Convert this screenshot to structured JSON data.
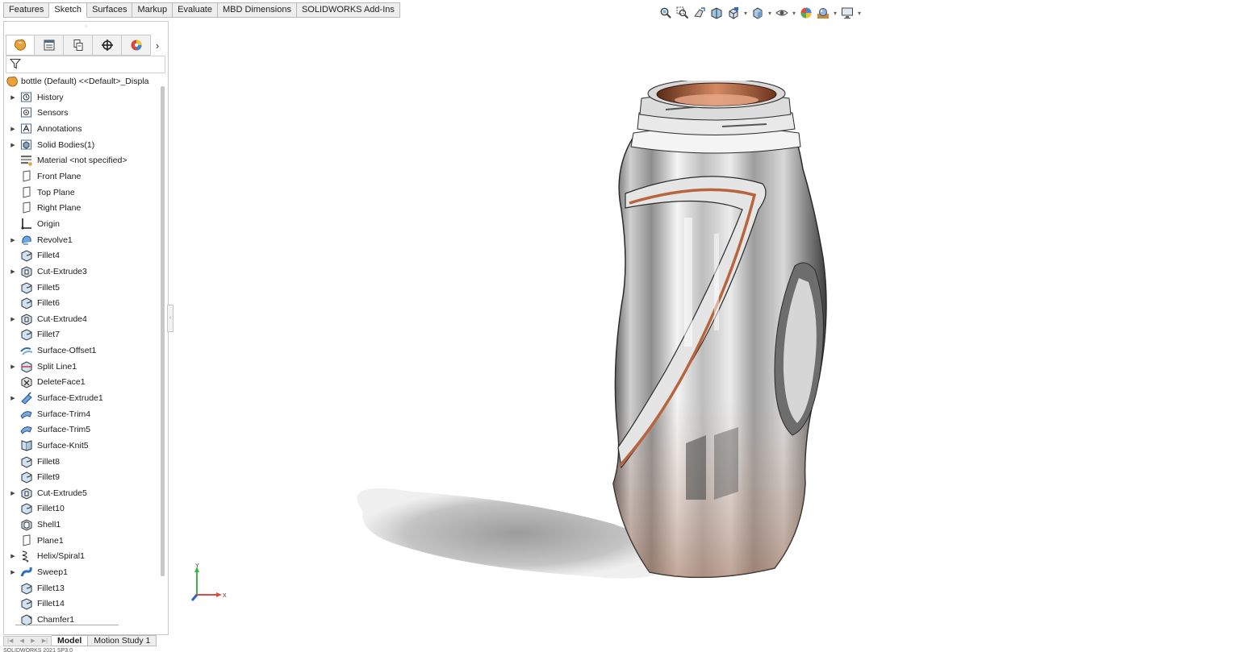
{
  "command_tabs": [
    "Features",
    "Sketch",
    "Surfaces",
    "Markup",
    "Evaluate",
    "MBD Dimensions",
    "SOLIDWORKS Add-Ins"
  ],
  "active_command_tab": "Sketch",
  "hud_icons": [
    "zoom-to-fit-icon",
    "zoom-to-area-icon",
    "previous-view-icon",
    "section-view-icon",
    "view-orientation-icon",
    "display-style-icon",
    "hide-show-items-icon",
    "edit-appearance-icon",
    "apply-scene-icon",
    "view-settings-icon"
  ],
  "feature_manager": {
    "tabs": [
      "featuremanager-tab",
      "propertymanager-tab",
      "configurationmanager-tab",
      "dimxpertmanager-tab",
      "displaymanager-tab"
    ],
    "more": "›",
    "root": "bottle (Default) <<Default>_Displa",
    "items": [
      {
        "label": "History",
        "expand": true,
        "icon": "history"
      },
      {
        "label": "Sensors",
        "expand": false,
        "icon": "sensor"
      },
      {
        "label": "Annotations",
        "expand": true,
        "icon": "annotation"
      },
      {
        "label": "Solid Bodies(1)",
        "expand": true,
        "icon": "solid-body"
      },
      {
        "label": "Material <not specified>",
        "expand": false,
        "icon": "material"
      },
      {
        "label": "Front Plane",
        "expand": false,
        "icon": "plane"
      },
      {
        "label": "Top Plane",
        "expand": false,
        "icon": "plane"
      },
      {
        "label": "Right Plane",
        "expand": false,
        "icon": "plane"
      },
      {
        "label": "Origin",
        "expand": false,
        "icon": "origin"
      },
      {
        "label": "Revolve1",
        "expand": true,
        "icon": "revolve"
      },
      {
        "label": "Fillet4",
        "expand": false,
        "icon": "fillet"
      },
      {
        "label": "Cut-Extrude3",
        "expand": true,
        "icon": "cut-extrude"
      },
      {
        "label": "Fillet5",
        "expand": false,
        "icon": "fillet"
      },
      {
        "label": "Fillet6",
        "expand": false,
        "icon": "fillet"
      },
      {
        "label": "Cut-Extrude4",
        "expand": true,
        "icon": "cut-extrude"
      },
      {
        "label": "Fillet7",
        "expand": false,
        "icon": "fillet"
      },
      {
        "label": "Surface-Offset1",
        "expand": false,
        "icon": "surface-offset"
      },
      {
        "label": "Split Line1",
        "expand": true,
        "icon": "split-line"
      },
      {
        "label": "DeleteFace1",
        "expand": false,
        "icon": "delete-face"
      },
      {
        "label": "Surface-Extrude1",
        "expand": true,
        "icon": "surface-extrude"
      },
      {
        "label": "Surface-Trim4",
        "expand": false,
        "icon": "surface-trim"
      },
      {
        "label": "Surface-Trim5",
        "expand": false,
        "icon": "surface-trim"
      },
      {
        "label": "Surface-Knit5",
        "expand": false,
        "icon": "surface-knit"
      },
      {
        "label": "Fillet8",
        "expand": false,
        "icon": "fillet"
      },
      {
        "label": "Fillet9",
        "expand": false,
        "icon": "fillet"
      },
      {
        "label": "Cut-Extrude5",
        "expand": true,
        "icon": "cut-extrude"
      },
      {
        "label": "Fillet10",
        "expand": false,
        "icon": "fillet"
      },
      {
        "label": "Shell1",
        "expand": false,
        "icon": "shell"
      },
      {
        "label": "Plane1",
        "expand": false,
        "icon": "plane"
      },
      {
        "label": "Helix/Spiral1",
        "expand": true,
        "icon": "helix"
      },
      {
        "label": "Sweep1",
        "expand": true,
        "icon": "sweep"
      },
      {
        "label": "Fillet13",
        "expand": false,
        "icon": "fillet"
      },
      {
        "label": "Fillet14",
        "expand": false,
        "icon": "fillet"
      },
      {
        "label": "Chamfer1",
        "expand": false,
        "icon": "chamfer"
      }
    ]
  },
  "bottom_tabs": [
    "Model",
    "Motion Study 1"
  ],
  "active_bottom_tab": "Model",
  "status_bar": "SOLIDWORKS 2021 SP3.0",
  "triad": {
    "y": "Y",
    "x": "X"
  },
  "colors": {
    "accent": "#1f5fa8",
    "copper": "#b8643e",
    "tab_bg": "#eeeeee",
    "border": "#b8b8b8"
  }
}
